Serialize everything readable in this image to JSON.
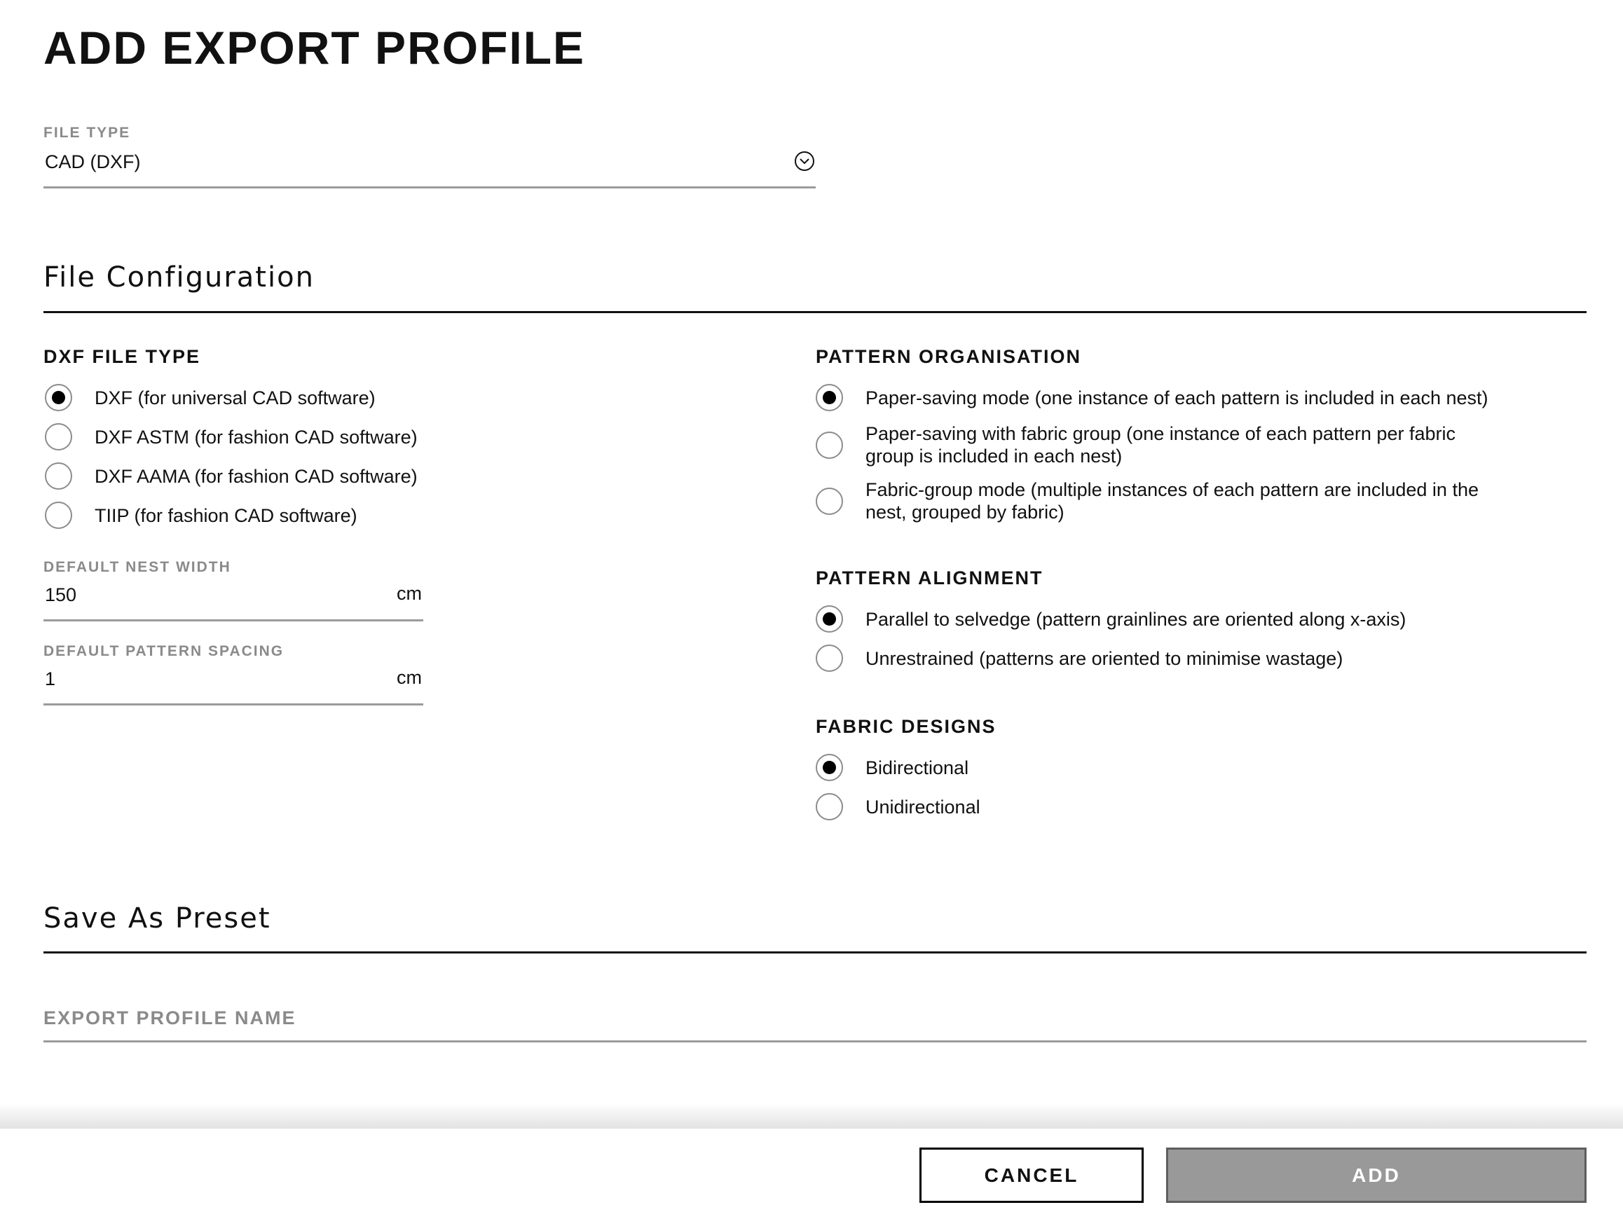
{
  "dialog": {
    "title": "ADD EXPORT PROFILE"
  },
  "file_type": {
    "label": "FILE TYPE",
    "value": "CAD (DXF)",
    "icon": "chevron-down-circle-icon"
  },
  "file_configuration": {
    "title": "File Configuration",
    "dxf_file_type": {
      "title": "DXF FILE TYPE",
      "options": [
        {
          "label": "DXF (for universal CAD software)",
          "checked": true
        },
        {
          "label": "DXF ASTM (for fashion CAD software)",
          "checked": false
        },
        {
          "label": "DXF AAMA (for fashion CAD software)",
          "checked": false
        },
        {
          "label": "TIIP (for fashion CAD software)",
          "checked": false
        }
      ]
    },
    "default_nest_width": {
      "label": "DEFAULT NEST WIDTH",
      "value": "150",
      "unit": "cm"
    },
    "default_pattern_spacing": {
      "label": "DEFAULT PATTERN SPACING",
      "value": "1",
      "unit": "cm"
    },
    "pattern_organisation": {
      "title": "PATTERN ORGANISATION",
      "options": [
        {
          "label": "Paper-saving mode (one instance of each pattern is included in each nest)",
          "checked": true
        },
        {
          "label": "Paper-saving with fabric group (one instance of each pattern per fabric group is included in each nest)",
          "checked": false
        },
        {
          "label": "Fabric-group mode (multiple instances of each pattern are included in the nest, grouped by fabric)",
          "checked": false
        }
      ]
    },
    "pattern_alignment": {
      "title": "PATTERN ALIGNMENT",
      "options": [
        {
          "label": "Parallel to selvedge (pattern grainlines are oriented along x-axis)",
          "checked": true
        },
        {
          "label": "Unrestrained (patterns are oriented to minimise wastage)",
          "checked": false
        }
      ]
    },
    "fabric_designs": {
      "title": "FABRIC DESIGNS",
      "options": [
        {
          "label": "Bidirectional",
          "checked": true
        },
        {
          "label": "Unidirectional",
          "checked": false
        }
      ]
    }
  },
  "save_as_preset": {
    "title": "Save As Preset",
    "export_profile_name": {
      "placeholder": "EXPORT PROFILE NAME",
      "value": ""
    }
  },
  "footer": {
    "cancel_label": "CANCEL",
    "add_label": "ADD",
    "add_enabled": false
  },
  "colors": {
    "text": "#111111",
    "label_gray": "#8a8a8a",
    "underline_gray": "#9b9b9b",
    "add_button_bg": "#999999",
    "add_button_border": "#5e5e5e"
  }
}
